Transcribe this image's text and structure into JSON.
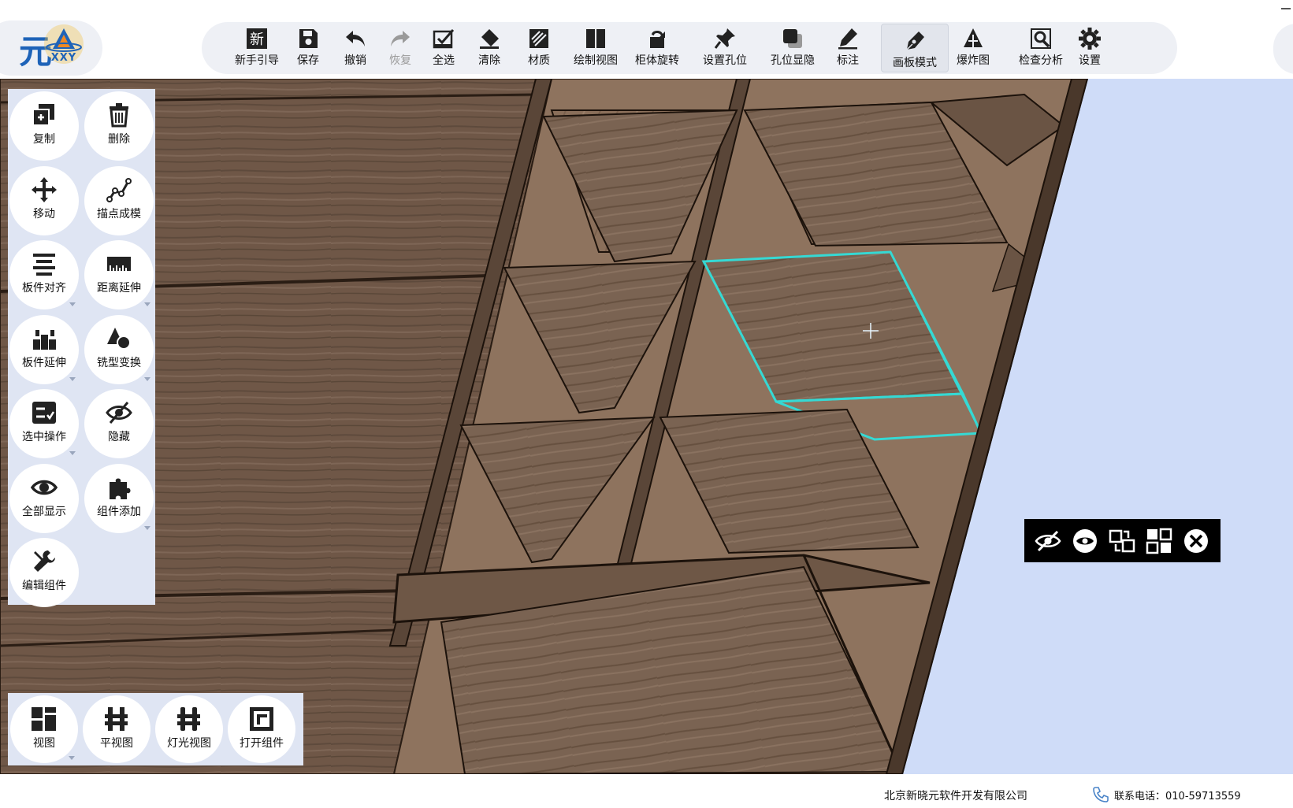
{
  "logo": {
    "char": "元",
    "text": "XXY"
  },
  "toolbar": [
    {
      "icon": "new-guide-icon",
      "label": "新手引导",
      "state": "normal"
    },
    {
      "icon": "save-icon",
      "label": "保存",
      "state": "normal"
    },
    {
      "icon": "undo-icon",
      "label": "撤销",
      "state": "normal"
    },
    {
      "icon": "redo-icon",
      "label": "恢复",
      "state": "disabled"
    },
    {
      "icon": "select-all-icon",
      "label": "全选",
      "state": "normal"
    },
    {
      "icon": "eraser-icon",
      "label": "清除",
      "state": "normal"
    },
    {
      "icon": "material-icon",
      "label": "材质",
      "state": "normal"
    },
    {
      "icon": "draw-view-icon",
      "label": "绘制视图",
      "state": "normal"
    },
    {
      "icon": "rotate-cabinet-icon",
      "label": "柜体旋转",
      "state": "normal"
    },
    {
      "icon": "pin-icon",
      "label": "设置孔位",
      "state": "normal"
    },
    {
      "icon": "hole-toggle-icon",
      "label": "孔位显隐",
      "state": "normal"
    },
    {
      "icon": "annotate-icon",
      "label": "标注",
      "state": "normal"
    },
    {
      "icon": "pen-icon",
      "label": "画板模式",
      "state": "active"
    },
    {
      "icon": "explode-icon",
      "label": "爆炸图",
      "state": "normal"
    },
    {
      "icon": "inspect-icon",
      "label": "检查分析",
      "state": "normal"
    },
    {
      "icon": "gear-icon",
      "label": "设置",
      "state": "normal"
    }
  ],
  "left_tools": [
    {
      "icon": "copy-icon",
      "label": "复制",
      "has_menu": false
    },
    {
      "icon": "trash-icon",
      "label": "删除",
      "has_menu": false
    },
    {
      "icon": "move-icon",
      "label": "移动",
      "has_menu": false
    },
    {
      "icon": "node-model-icon",
      "label": "描点成模",
      "has_menu": false
    },
    {
      "icon": "align-icon",
      "label": "板件对齐",
      "has_menu": true
    },
    {
      "icon": "ruler-icon",
      "label": "距离延伸",
      "has_menu": true
    },
    {
      "icon": "extend-icon",
      "label": "板件延伸",
      "has_menu": true
    },
    {
      "icon": "shape-icon",
      "label": "铣型变换",
      "has_menu": true
    },
    {
      "icon": "checklist-icon",
      "label": "选中操作",
      "has_menu": true
    },
    {
      "icon": "eye-off-icon",
      "label": "隐藏",
      "has_menu": false
    },
    {
      "icon": "eye-icon",
      "label": "全部显示",
      "has_menu": false
    },
    {
      "icon": "puzzle-icon",
      "label": "组件添加",
      "has_menu": true
    },
    {
      "icon": "wrench-icon",
      "label": "编辑组件",
      "has_menu": false
    }
  ],
  "view_tools": [
    {
      "icon": "views-icon",
      "label": "视图",
      "has_menu": true
    },
    {
      "icon": "flat-view-icon",
      "label": "平视图",
      "has_menu": false
    },
    {
      "icon": "light-view-icon",
      "label": "灯光视图",
      "has_menu": false
    },
    {
      "icon": "open-component-icon",
      "label": "打开组件",
      "has_menu": false
    }
  ],
  "float_bar": [
    {
      "icon": "hide-icon"
    },
    {
      "icon": "show-icon"
    },
    {
      "icon": "select-swap-icon"
    },
    {
      "icon": "component-icon"
    },
    {
      "icon": "close-icon"
    }
  ],
  "status": {
    "company": "北京新晓元软件开发有限公司",
    "phone": "联系电话：010-59713559"
  },
  "colors": {
    "brand": "#1e63b8",
    "selection": "#35d9d4",
    "wood": "#6e5746",
    "sky": "#cfdcf8",
    "panel": "#dfe5f3"
  }
}
